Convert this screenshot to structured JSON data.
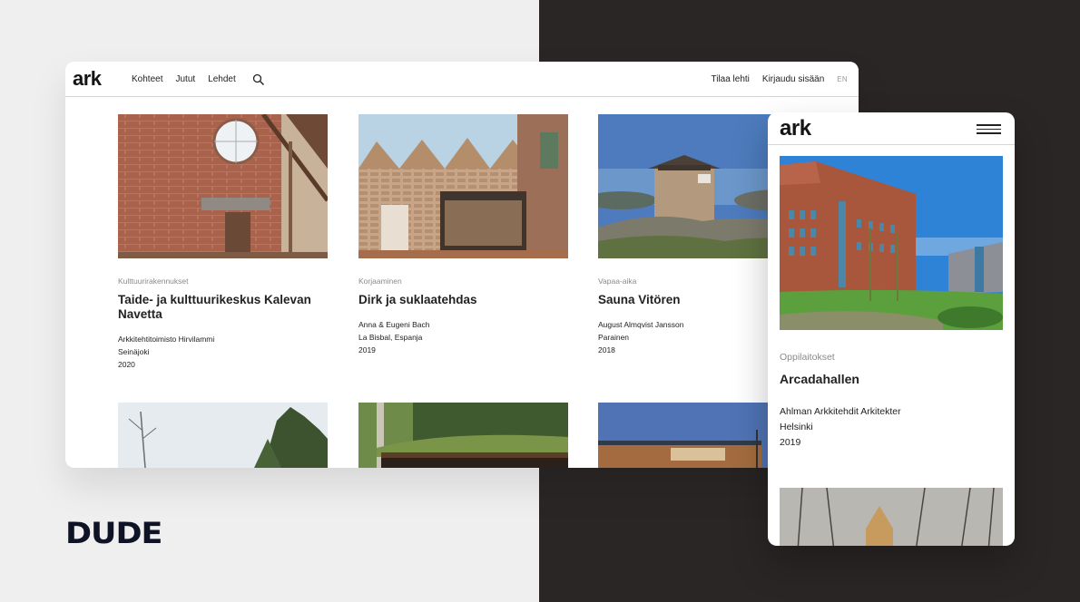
{
  "brand": {
    "name": "DUDE"
  },
  "desktop": {
    "logo": "ark",
    "nav": [
      "Kohteet",
      "Jutut",
      "Lehdet"
    ],
    "search_icon": "search-icon",
    "right": {
      "subscribe": "Tilaa lehti",
      "login": "Kirjaudu sisään",
      "lang": "EN"
    },
    "cards": [
      {
        "category": "Kulttuurirakennukset",
        "title": "Taide- ja kulttuurikeskus Kalevan Navetta",
        "architect": "Arkkitehtitoimisto Hirvilammi",
        "location": "Seinäjoki",
        "year": "2020"
      },
      {
        "category": "Korjaaminen",
        "title": "Dirk ja suklaatehdas",
        "architect": "Anna & Eugeni Bach",
        "location": "La Bisbal, Espanja",
        "year": "2019"
      },
      {
        "category": "Vapaa-aika",
        "title": "Sauna Vitören",
        "architect": "August Almqvist Jansson",
        "location": "Parainen",
        "year": "2018"
      }
    ]
  },
  "mobile": {
    "logo": "ark",
    "menu_icon": "hamburger-icon",
    "card": {
      "category": "Oppilaitokset",
      "title": "Arcadahallen",
      "architect": "Ahlman Arkkitehdit Arkitekter",
      "location": "Helsinki",
      "year": "2019"
    }
  }
}
